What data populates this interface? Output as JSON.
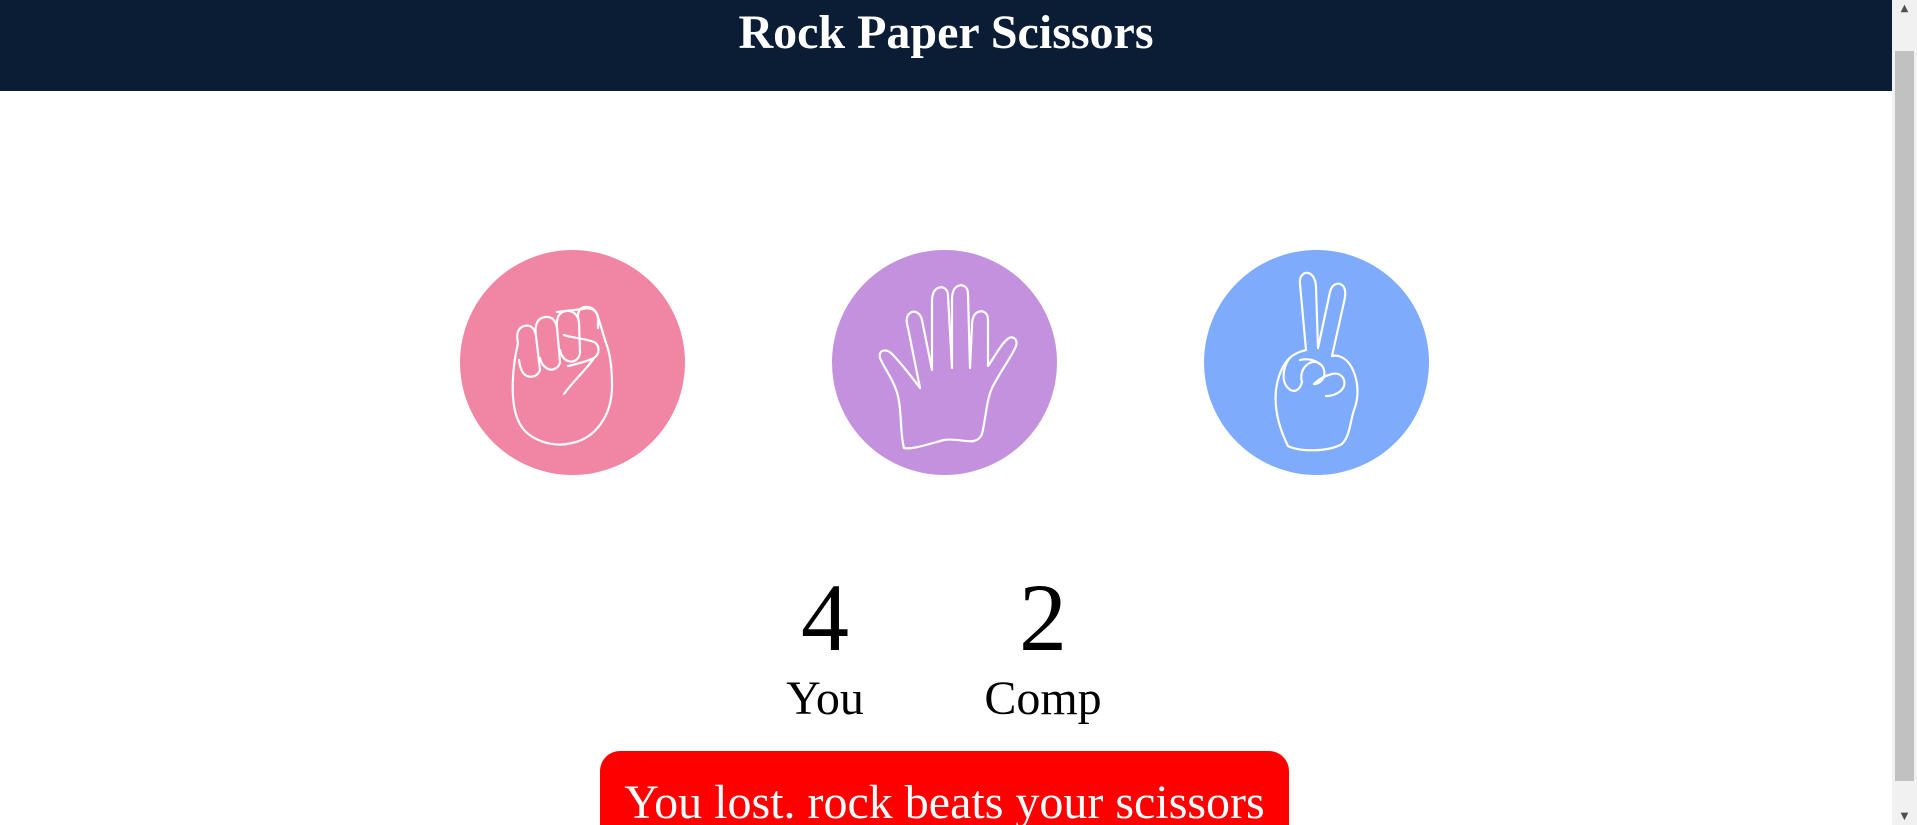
{
  "header": {
    "title": "Rock Paper Scissors",
    "background": "#0b1d35"
  },
  "choices": [
    {
      "id": "rock",
      "icon": "fist-icon",
      "color": "#f086a3"
    },
    {
      "id": "paper",
      "icon": "open-hand-icon",
      "color": "#c391de"
    },
    {
      "id": "scissors",
      "icon": "peace-sign-icon",
      "color": "#7eabfc"
    }
  ],
  "scoreboard": {
    "user": {
      "score": "4",
      "label": "You"
    },
    "comp": {
      "score": "2",
      "label": "Comp"
    }
  },
  "result": {
    "message": "You lost. rock beats your scissors",
    "color": "#ff0000"
  }
}
